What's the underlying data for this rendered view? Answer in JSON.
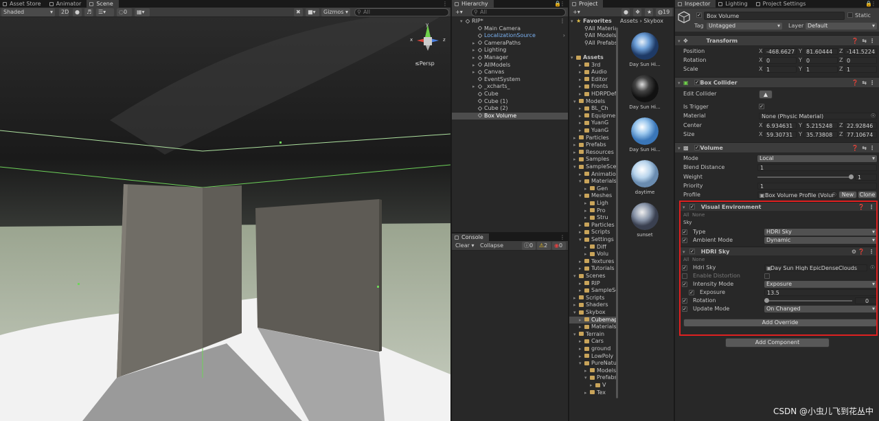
{
  "scene": {
    "tabs": [
      "Asset Store",
      "Animator",
      "Scene"
    ],
    "active_tab": "Scene",
    "shading": "Shaded",
    "btn_2d": "2D",
    "hidden_count": "0",
    "gizmos": "Gizmos",
    "search_placeholder": "All",
    "persp": "≤Persp",
    "axis_x": "x",
    "axis_y": "y",
    "axis_z": "z"
  },
  "hierarchy": {
    "title": "Hierarchy",
    "search_placeholder": "All",
    "root": "RIP*",
    "items": [
      "Main Camera",
      "LocalizationSource",
      "CameraPaths",
      "Lighting",
      "Manager",
      "AllModels",
      "Canvas",
      "EventSystem",
      "_xcharts_",
      "Cube",
      "Cube (1)",
      "Cube (2)",
      "Box Volume"
    ]
  },
  "console": {
    "title": "Console",
    "clear": "Clear",
    "collapse": "Collapse",
    "count_info": "0",
    "count_warn": "2",
    "count_error": "0"
  },
  "project": {
    "title": "Project",
    "favorites": "Favorites",
    "fav_items": [
      "All Materials",
      "All Models",
      "All Prefabs"
    ],
    "assets_root": "Assets",
    "tree": [
      "3rd",
      "Audio",
      "Editor",
      "Fronts",
      "HDRPDefaultResources",
      "Models",
      "BL_Ch",
      "Equipment",
      "YuanG",
      "YuanG",
      "Particles",
      "Prefabs",
      "Resources",
      "Samples",
      "SampleScenes",
      "Animations",
      "Materials",
      "Gen",
      "Meshes",
      "Ligh",
      "Pro",
      "Stru",
      "Particles",
      "Scripts",
      "Settings",
      "Diff",
      "Volu",
      "Textures",
      "Tutorials",
      "Scenes",
      "RIP",
      "SampleScenes",
      "Scripts",
      "Shaders",
      "Skybox",
      "Cubemaps",
      "Materials",
      "Terrain",
      "Cars",
      "ground",
      "LowPoly",
      "PureNature",
      "Models",
      "Prefabs",
      "V",
      "Tex"
    ],
    "breadcrumb": [
      "Assets",
      "Skybox"
    ],
    "visible_count": "19",
    "assets": [
      "Day Sun Hi...",
      "Day Sun Hi...",
      "Day Sun Hi...",
      "daytime",
      "sunset"
    ]
  },
  "inspector": {
    "tabs": [
      "Inspector",
      "Lighting",
      "Project Settings"
    ],
    "object_name": "Box Volume",
    "static_label": "Static",
    "tag_label": "Tag",
    "tag_value": "Untagged",
    "layer_label": "Layer",
    "layer_value": "Default",
    "transform": {
      "title": "Transform",
      "position_label": "Position",
      "position": [
        "-468.6627",
        "81.60444",
        "-141.5224"
      ],
      "rotation_label": "Rotation",
      "rotation": [
        "0",
        "0",
        "0"
      ],
      "scale_label": "Scale",
      "scale": [
        "1",
        "1",
        "1"
      ]
    },
    "box_collider": {
      "title": "Box Collider",
      "edit_collider": "Edit Collider",
      "is_trigger": "Is Trigger",
      "material_label": "Material",
      "material_value": "None (Physic Material)",
      "center_label": "Center",
      "center": [
        "6.934631",
        "5.215248",
        "22.92846"
      ],
      "size_label": "Size",
      "size": [
        "59.30731",
        "35.73808",
        "77.10674"
      ]
    },
    "volume": {
      "title": "Volume",
      "mode_label": "Mode",
      "mode_value": "Local",
      "blend_label": "Blend Distance",
      "blend_value": "1",
      "weight_label": "Weight",
      "weight_value": "1",
      "priority_label": "Priority",
      "priority_value": "1",
      "profile_label": "Profile",
      "profile_value": "Box Volume Profile (Volur",
      "new_btn": "New",
      "clone_btn": "Clone"
    },
    "visual_env": {
      "title": "Visual Environment",
      "all": "All",
      "none": "None",
      "sky_group": "Sky",
      "type_label": "Type",
      "type_value": "HDRI Sky",
      "ambient_label": "Ambient Mode",
      "ambient_value": "Dynamic"
    },
    "hdri_sky": {
      "title": "HDRI Sky",
      "all": "All",
      "none": "None",
      "hdri_label": "Hdri Sky",
      "hdri_value": "Day Sun High EpicDenseClouds",
      "distortion_label": "Enable Distortion",
      "intensity_label": "Intensity Mode",
      "intensity_value": "Exposure",
      "exposure_label": "Exposure",
      "exposure_value": "13.5",
      "rotation_label": "Rotation",
      "rotation_value": "0",
      "update_label": "Update Mode",
      "update_value": "On Changed"
    },
    "add_override": "Add Override",
    "add_component": "Add Component"
  },
  "watermark": "CSDN @小虫儿飞到花丛中",
  "colors": {
    "highlight_box": "#e02020",
    "accent": "#4a9ff5"
  }
}
